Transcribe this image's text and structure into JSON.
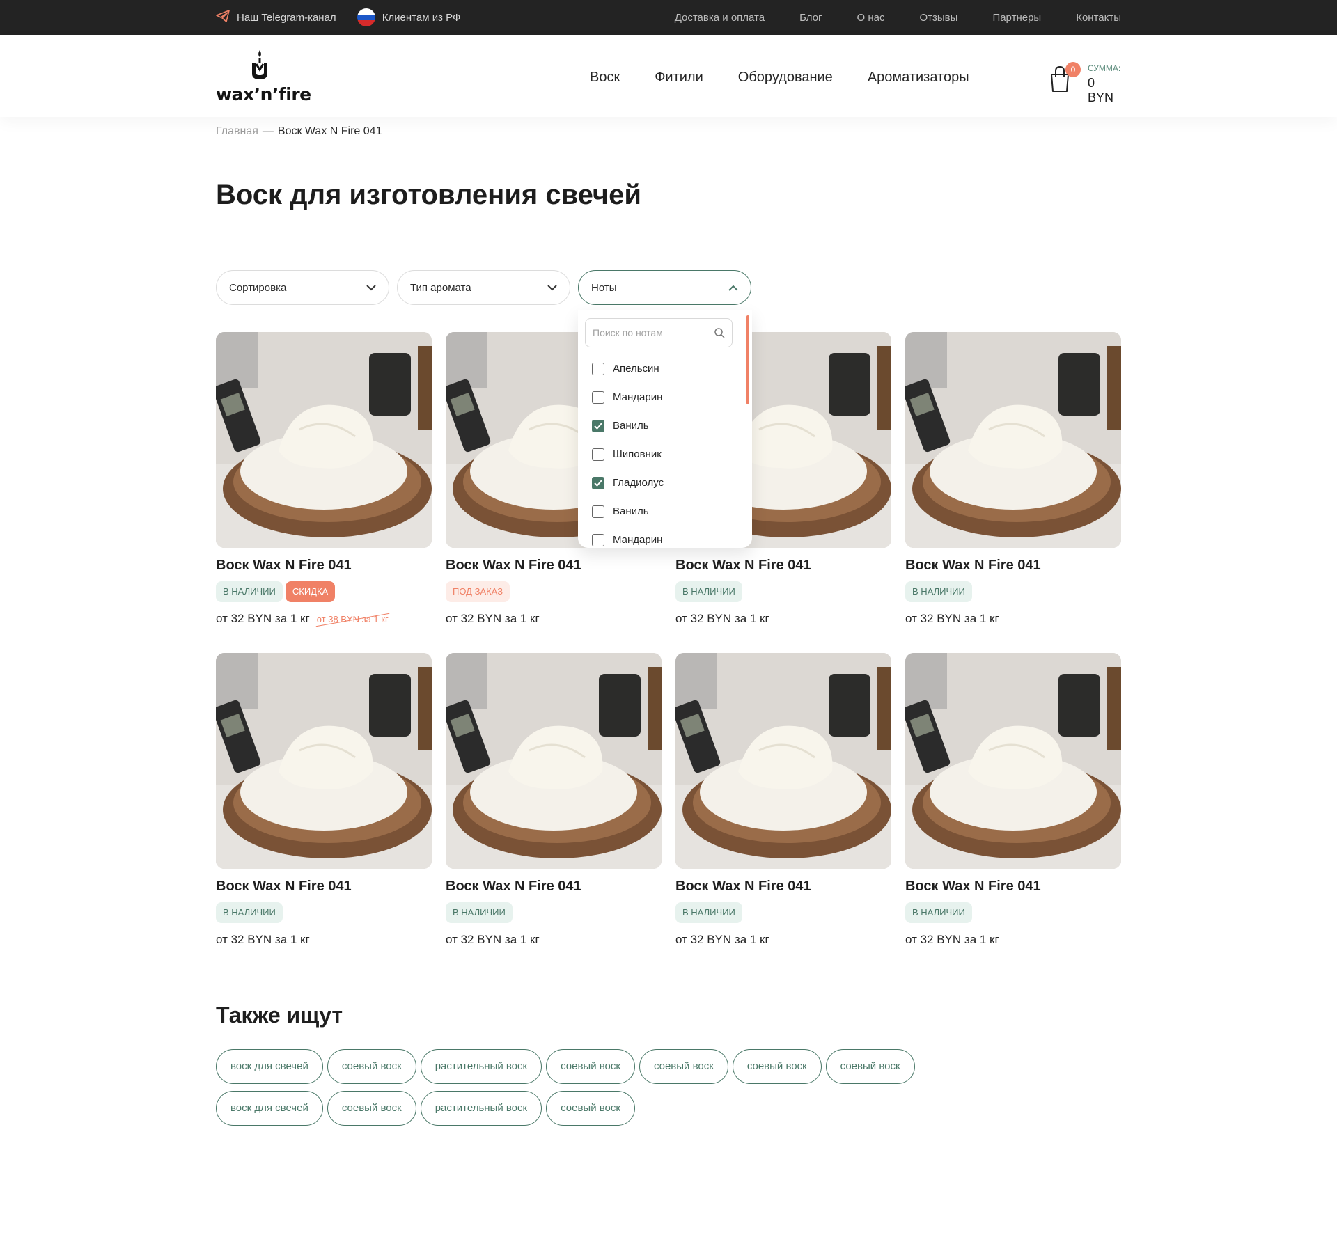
{
  "topbar": {
    "telegram_label": "Наш Telegram-канал",
    "russia_label": "Клиентам из РФ",
    "links": [
      "Доставка и оплата",
      "Блог",
      "О нас",
      "Отзывы",
      "Партнеры",
      "Контакты"
    ]
  },
  "header": {
    "logo_text": "wax’n’fire",
    "nav": [
      "Воск",
      "Фитили",
      "Оборудование",
      "Ароматизаторы"
    ],
    "cart_count": "0",
    "cart_sum_label": "СУММА:",
    "cart_sum_value": "0 BYN"
  },
  "breadcrumb": {
    "home": "Главная",
    "separator": "—",
    "current": "Воск Wax N Fire 041"
  },
  "page_title": "Воск для изготовления свечей",
  "filters": {
    "sort": "Сортировка",
    "aroma_type": "Тип аромата",
    "notes": "Ноты"
  },
  "notes_dropdown": {
    "search_placeholder": "Поиск по нотам",
    "items": [
      {
        "label": "Апельсин",
        "checked": false
      },
      {
        "label": "Мандарин",
        "checked": false
      },
      {
        "label": "Ваниль",
        "checked": true
      },
      {
        "label": "Шиповник",
        "checked": false
      },
      {
        "label": "Гладиолус",
        "checked": true
      },
      {
        "label": "Ваниль",
        "checked": false
      },
      {
        "label": "Мандарин",
        "checked": false
      }
    ]
  },
  "products": [
    {
      "name": "Воск Wax N Fire 041",
      "badges": [
        "В НАЛИЧИИ",
        "СКИДКА"
      ],
      "price": "от 32 BYN за 1 кг",
      "old_price": "от 38 BYN за 1 кг"
    },
    {
      "name": "Воск Wax N Fire 041",
      "badges": [
        "ПОД ЗАКАЗ"
      ],
      "price": "от 32 BYN за 1 кг",
      "old_price": ""
    },
    {
      "name": "Воск Wax N Fire 041",
      "badges": [
        "В НАЛИЧИИ"
      ],
      "price": "от 32 BYN за 1 кг",
      "old_price": ""
    },
    {
      "name": "Воск Wax N Fire 041",
      "badges": [
        "В НАЛИЧИИ"
      ],
      "price": "от 32 BYN за 1 кг",
      "old_price": ""
    },
    {
      "name": "Воск Wax N Fire 041",
      "badges": [
        "В НАЛИЧИИ"
      ],
      "price": "от 32 BYN за 1 кг",
      "old_price": ""
    },
    {
      "name": "Воск Wax N Fire 041",
      "badges": [
        "В НАЛИЧИИ"
      ],
      "price": "от 32 BYN за 1 кг",
      "old_price": ""
    },
    {
      "name": "Воск Wax N Fire 041",
      "badges": [
        "В НАЛИЧИИ"
      ],
      "price": "от 32 BYN за 1 кг",
      "old_price": ""
    },
    {
      "name": "Воск Wax N Fire 041",
      "badges": [
        "В НАЛИЧИИ"
      ],
      "price": "от 32 BYN за 1 кг",
      "old_price": ""
    }
  ],
  "also_search": {
    "title": "Также ищут",
    "tags": [
      "воск для свечей",
      "соевый воск",
      "растительный воск",
      "соевый воск",
      "соевый воск",
      "соевый воск",
      "соевый воск",
      "воск для свечей",
      "соевый воск",
      "растительный воск",
      "соевый воск"
    ]
  },
  "colors": {
    "accent": "#f08166",
    "primary_green": "#4a7868",
    "topbar_bg": "#232323"
  }
}
